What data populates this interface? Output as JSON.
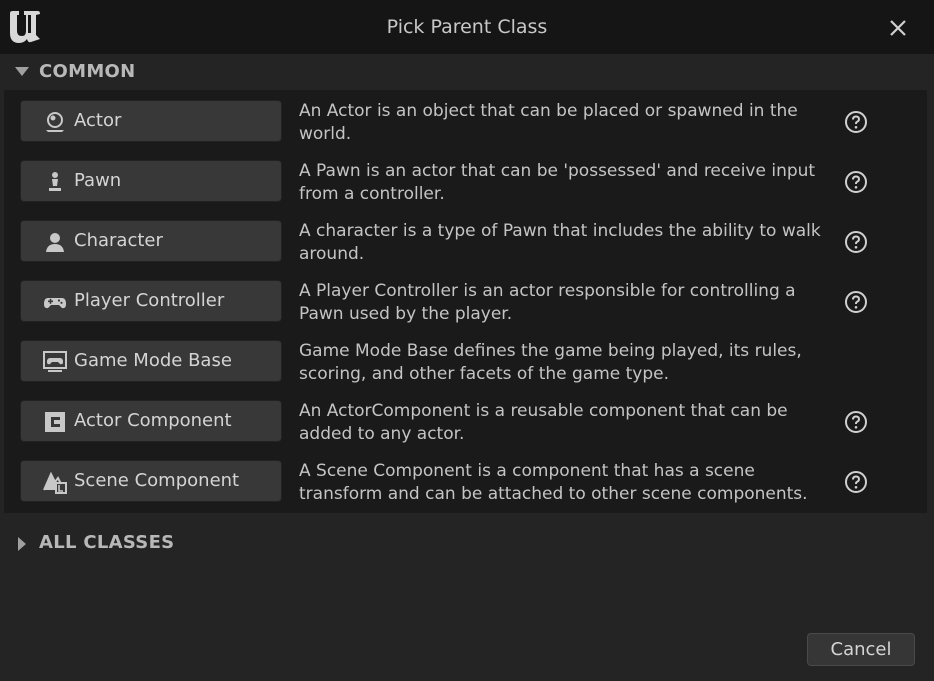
{
  "window": {
    "title": "Pick Parent Class"
  },
  "sections": {
    "common": {
      "label": "COMMON",
      "expanded": true
    },
    "all_classes": {
      "label": "ALL CLASSES",
      "expanded": false
    }
  },
  "classes": [
    {
      "label": "Actor",
      "icon": "actor-icon",
      "description": "An Actor is an object that can be placed or spawned in the world.",
      "has_help": true
    },
    {
      "label": "Pawn",
      "icon": "pawn-icon",
      "description": "A Pawn is an actor that can be 'possessed' and receive input from a controller.",
      "has_help": true
    },
    {
      "label": "Character",
      "icon": "character-icon",
      "description": "A character is a type of Pawn that includes the ability to walk around.",
      "has_help": true
    },
    {
      "label": "Player Controller",
      "icon": "gamepad-icon",
      "description": "A Player Controller is an actor responsible for controlling a Pawn used by the player.",
      "has_help": true
    },
    {
      "label": "Game Mode Base",
      "icon": "game-mode-icon",
      "description": "Game Mode Base defines the game being played, its rules, scoring, and other facets of the game type.",
      "has_help": false
    },
    {
      "label": "Actor Component",
      "icon": "actor-component-icon",
      "description": "An ActorComponent is a reusable component that can be added to any actor.",
      "has_help": true
    },
    {
      "label": "Scene Component",
      "icon": "scene-component-icon",
      "description": "A Scene Component is a component that has a scene transform and can be attached to other scene components.",
      "has_help": true
    }
  ],
  "footer": {
    "cancel_label": "Cancel"
  },
  "colors": {
    "background": "#242424",
    "titlebar": "#151515",
    "panel": "#1a1a1a",
    "button": "#383838",
    "text": "#c4c4c4"
  }
}
